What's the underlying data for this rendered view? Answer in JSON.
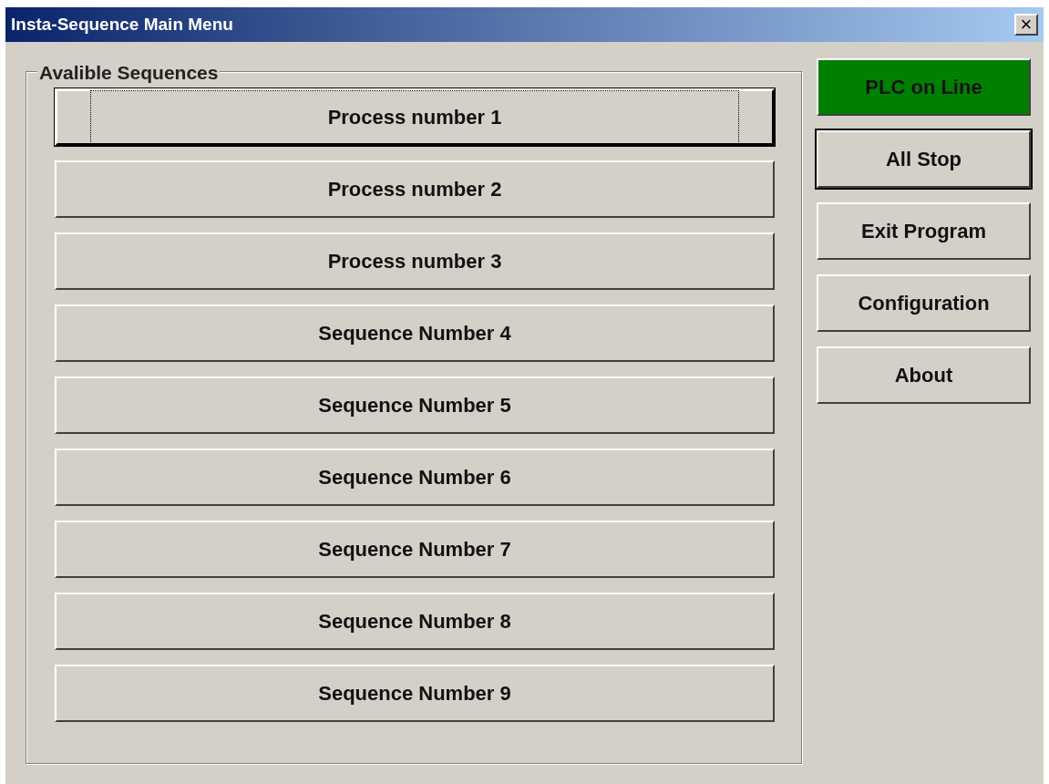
{
  "window": {
    "title": "Insta-Sequence Main Menu",
    "close": "×"
  },
  "group": {
    "label": "Avalible Sequences",
    "sequences": [
      {
        "label": "Process number 1",
        "focused": true
      },
      {
        "label": "Process number 2",
        "focused": false
      },
      {
        "label": "Process number 3",
        "focused": false
      },
      {
        "label": "Sequence Number 4",
        "focused": false
      },
      {
        "label": "Sequence Number 5",
        "focused": false
      },
      {
        "label": "Sequence Number 6",
        "focused": false
      },
      {
        "label": "Sequence Number 7",
        "focused": false
      },
      {
        "label": "Sequence Number 8",
        "focused": false
      },
      {
        "label": "Sequence Number 9",
        "focused": false
      }
    ]
  },
  "plc_status": {
    "label": "PLC on Line",
    "online": true
  },
  "buttons": [
    {
      "label": "All Stop",
      "default": true
    },
    {
      "label": "Exit Program",
      "default": false
    },
    {
      "label": "Configuration",
      "default": false
    },
    {
      "label": "About",
      "default": false
    }
  ]
}
